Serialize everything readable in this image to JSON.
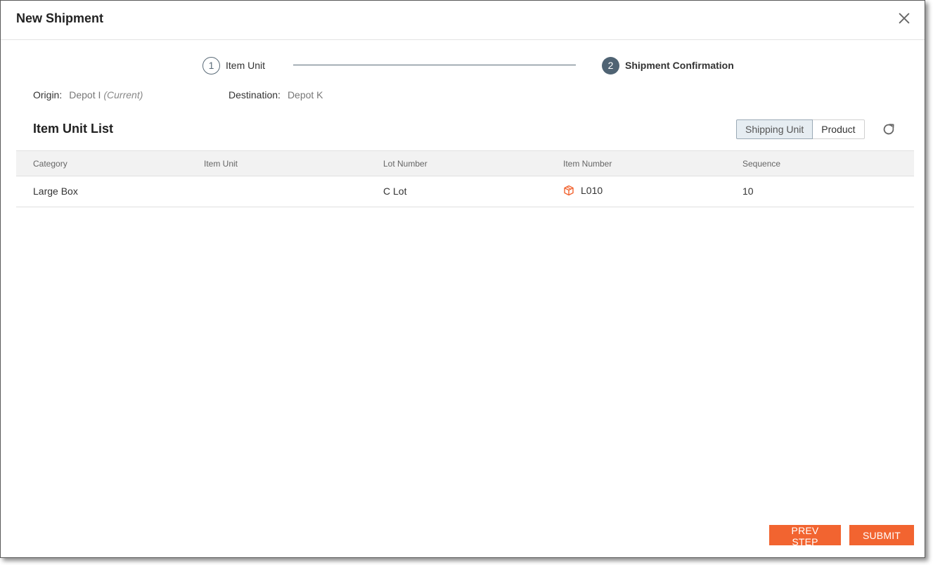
{
  "dialog": {
    "title": "New Shipment",
    "close_icon": "close-icon"
  },
  "stepper": {
    "steps": [
      {
        "number": "1",
        "label": "Item Unit",
        "state": "completed"
      },
      {
        "number": "2",
        "label": "Shipment Confirmation",
        "state": "active"
      }
    ]
  },
  "route": {
    "origin_label": "Origin:",
    "origin_value": "Depot I",
    "origin_note": "(Current)",
    "destination_label": "Destination:",
    "destination_value": "Depot K"
  },
  "list": {
    "title": "Item Unit List",
    "view_options": [
      "Shipping Unit",
      "Product"
    ],
    "selected_view": "Shipping Unit",
    "refresh_icon": "refresh-icon"
  },
  "table": {
    "columns": [
      "Category",
      "Item Unit",
      "Lot Number",
      "Item Number",
      "Sequence"
    ],
    "rows": [
      {
        "category": "Large Box",
        "item_unit": "",
        "lot_number": "C Lot",
        "item_number": "L010",
        "item_icon": "box-icon",
        "sequence": "10"
      }
    ]
  },
  "footer": {
    "prev_label": "PREV STEP",
    "submit_label": "SUBMIT"
  },
  "colors": {
    "accent": "#f26430",
    "step_active": "#4f6373"
  }
}
